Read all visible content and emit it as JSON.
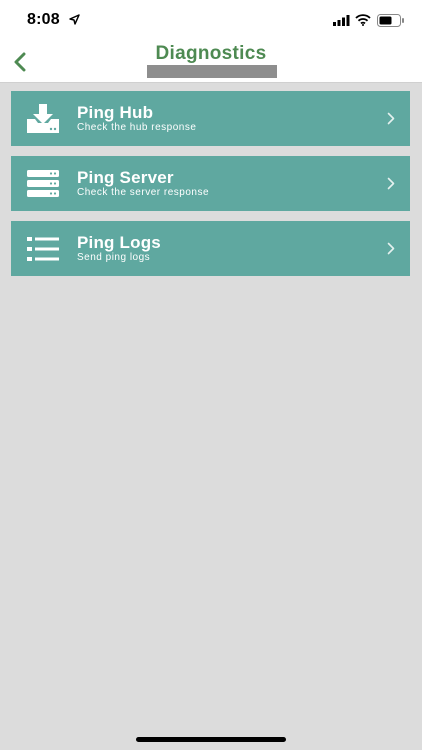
{
  "status": {
    "time": "8:08",
    "icons": [
      "location-arrow-icon",
      "cellular-signal-icon",
      "wifi-icon",
      "battery-icon"
    ]
  },
  "nav": {
    "title": "Diagnostics",
    "back_icon": "chevron-left-icon"
  },
  "menu": {
    "items": [
      {
        "title": "Ping Hub",
        "subtitle": "Check the hub response",
        "icon": "download-tray-icon"
      },
      {
        "title": "Ping Server",
        "subtitle": "Check the server response",
        "icon": "server-stack-icon"
      },
      {
        "title": "Ping Logs",
        "subtitle": "Send ping logs",
        "icon": "list-icon"
      }
    ]
  },
  "colors": {
    "accent_green": "#4e8a52",
    "tile_teal": "#5fa8a0",
    "background": "#dcdcdc",
    "redaction": "#8e8e8e"
  }
}
